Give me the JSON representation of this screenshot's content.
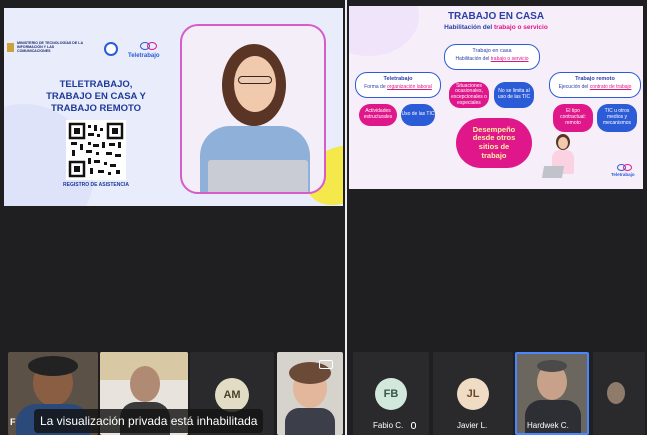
{
  "left_slide": {
    "ministry": "MINISTERIO DE TECNOLOGÍAS DE LA INFORMACIÓN Y LAS COMUNICACIONES",
    "brand": "Teletrabajo",
    "title_line1": "TELETRABAJO,",
    "title_line2": "TRABAJO EN CASA Y",
    "title_line3": "TRABAJO REMOTO",
    "qr_caption": "REGISTRO DE ASISTENCIA"
  },
  "right_slide": {
    "title": "TRABAJO EN CASA",
    "subtitle_prefix": "Habilitación del ",
    "subtitle_highlight": "trabajo o servicio",
    "center_box_title": "Trabajo en casa",
    "center_box_prefix": "Habilitación del ",
    "center_box_highlight": "trabajo o servicio",
    "left_box_title": "Teletrabajo",
    "left_box_prefix": "Forma de ",
    "left_box_highlight": "organización laboral",
    "right_box_title": "Trabajo remoto",
    "right_box_prefix": "Ejecución del ",
    "right_box_highlight": "contrato de trabajo",
    "pill1": "Actividades estructurales",
    "pill2": "Uso de las TIC",
    "pill3": "Situaciones ocasionales, excepcionales o especiales",
    "pill4": "No se limita al uso de las TIC",
    "pill5": "El tipo contractual: remoto",
    "pill6": "TIC u otros medios y mecanismos",
    "center_big": "Desempeño desde otros sitios de trabajo",
    "brand": "Teletrabajo"
  },
  "participants": {
    "p1_initial": "F",
    "am_initials": "AM",
    "fb_initials": "FB",
    "fb_name": "Fabio C.",
    "jl_initials": "JL",
    "jl_name": "Javier L.",
    "hw_name": "Hardwek C."
  },
  "banner": "La visualización privada está inhabilitada",
  "colors": {
    "accent_blue": "#2b5bd7",
    "magenta": "#e0178a",
    "purple": "#7a2fe0",
    "yellow": "#f4e84a"
  }
}
